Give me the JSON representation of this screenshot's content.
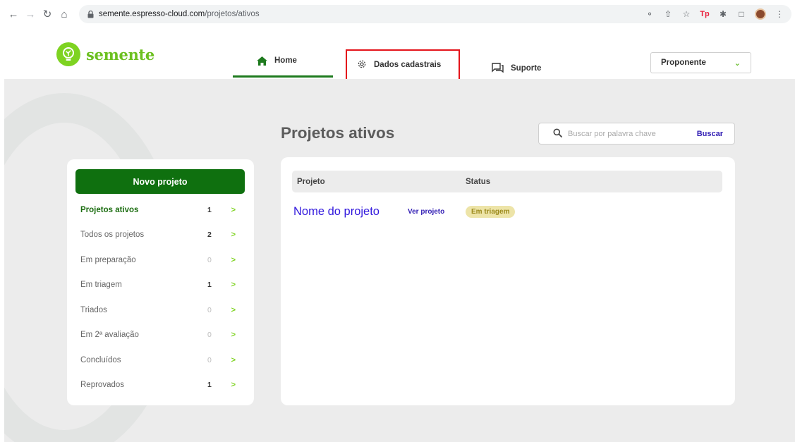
{
  "browser": {
    "url_host": "semente.espresso-cloud.com",
    "url_path": "/projetos/ativos"
  },
  "header": {
    "logo_text": "semente",
    "nav": {
      "home": "Home",
      "dados": "Dados cadastrais",
      "suporte": "Suporte"
    },
    "role_select": "Proponente"
  },
  "main": {
    "title": "Projetos ativos",
    "search": {
      "placeholder": "Buscar por palavra chave",
      "button": "Buscar"
    }
  },
  "sidebar": {
    "new_project": "Novo projeto",
    "items": [
      {
        "label": "Projetos ativos",
        "count": "1"
      },
      {
        "label": "Todos os projetos",
        "count": "2"
      },
      {
        "label": "Em preparação",
        "count": "0"
      },
      {
        "label": "Em triagem",
        "count": "1"
      },
      {
        "label": "Triados",
        "count": "0"
      },
      {
        "label": "Em 2ª avaliação",
        "count": "0"
      },
      {
        "label": "Concluídos",
        "count": "0"
      },
      {
        "label": "Reprovados",
        "count": "1"
      }
    ]
  },
  "table": {
    "headers": [
      "Projeto",
      "Status"
    ],
    "rows": [
      {
        "name": "Nome do projeto",
        "action": "Ver projeto",
        "status": "Em triagem"
      }
    ]
  },
  "colors": {
    "brand_green": "#0f700f",
    "accent_lime": "#7ed321",
    "link_blue": "#3521b5",
    "highlight_red": "#e4141b"
  }
}
